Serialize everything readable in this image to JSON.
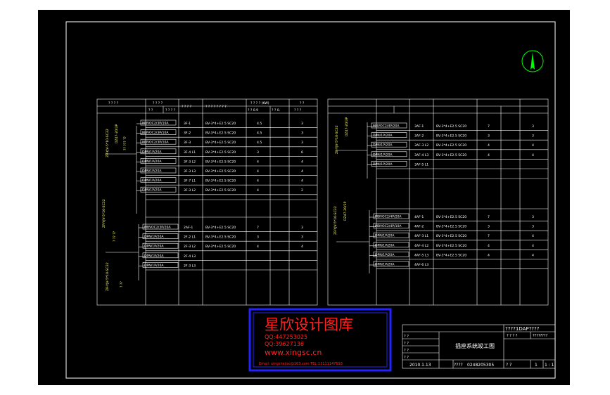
{
  "left_table": {
    "header": {
      "col_a": "? ? ? ?",
      "col_b": "? ? ? ?",
      "col_b_sub1": "? ?",
      "col_b_sub2": "? ? ? ?",
      "col_c": "? ? ? ?",
      "col_d": "? ? ? ? ? ? ? ?",
      "col_e": "? ? ? ? (KW)",
      "col_e_sub1": "? ? 0.9",
      "col_e_sub2": "? ? 0.",
      "col_f": "? ?",
      "col_f_sub": "? ? ?"
    },
    "side_labels": [
      "ZR-YJV-5*10-SC32",
      "DZ47-20/3P",
      "?? ??? ??",
      "ZR-YJV-5*10-SC32",
      "? ?? ??",
      "ZR-YJV-5*10-SC32",
      "? ??"
    ],
    "breaker_rows": [
      {
        "breaker": "MBVOC2/3P/10A",
        "circuit": "3F-1",
        "cable": "BV-3*4+E2.5 SC20",
        "kw": "4.5",
        "count": "3"
      },
      {
        "breaker": "MBVOC2/3P/10A",
        "circuit": "3F-2",
        "cable": "BV-3*4+E2.5 SC20",
        "kw": "4.5",
        "count": "3"
      },
      {
        "breaker": "MBVOC2/3P/10A",
        "circuit": "3F-3",
        "cable": "BV-3*4+E2.5 SC20",
        "kw": "4.5",
        "count": "3"
      },
      {
        "breaker": "DPN/1P/20A",
        "circuit": "3F-4 L1",
        "cable": "BV-3*4+E2.5 SC20",
        "kw": "3",
        "count": "6"
      },
      {
        "breaker": "DPN/1P/20A",
        "circuit": "3F-3 L2",
        "cable": "BV-3*4+E2.5 SC20",
        "kw": "4",
        "count": "4"
      },
      {
        "breaker": "DPN/1P/20A",
        "circuit": "3F-3 L3",
        "cable": "BV-3*4+E2.5 SC20",
        "kw": "4",
        "count": "4"
      },
      {
        "breaker": "DPN/1P/20A",
        "circuit": "3F-7 L1",
        "cable": "BV-3*4+E2.5 SC20",
        "kw": "4",
        "count": "4"
      },
      {
        "breaker": "DPN/1P/20A",
        "circuit": "3F-3 L2",
        "cable": "BV-3*4+E2.5 SC20",
        "kw": "4",
        "count": "2"
      }
    ],
    "breaker_rows_2": [
      {
        "breaker": "MBVOC2/3P/20A",
        "circuit": "2AF-1",
        "cable": "BV-3*4+E2.5 SC20",
        "kw": "7",
        "count": "3"
      },
      {
        "breaker": "DPN/1P/20A",
        "circuit": "2F-2 L1",
        "cable": "BV-3*4+E2.5 SC20",
        "kw": "3",
        "count": "3"
      },
      {
        "breaker": "DPN/1P/20A",
        "circuit": "2F-3 L2",
        "cable": "BV-3*4+E2.5 SC20",
        "kw": "4",
        "count": "4"
      },
      {
        "breaker": "DPN/1P/20A",
        "circuit": "2F-4 L3",
        "cable": "",
        "kw": "",
        "count": ""
      },
      {
        "breaker": "DPN/1P/20A",
        "circuit": "2F-3 L3",
        "cable": "",
        "kw": "",
        "count": ""
      }
    ]
  },
  "right_table": {
    "breaker_rows": [
      {
        "breaker": "MBVOC2/4P/20A",
        "circuit": "3AF-1",
        "cable": "BV-3*4+E2.5 SC20",
        "kw": "7",
        "count": "3"
      },
      {
        "breaker": "DPN/1P/20A",
        "circuit": "3AF-2",
        "cable": "BV-3*4+E2.5 SC20",
        "kw": "3",
        "count": "3"
      },
      {
        "breaker": "DPN/1P/20A",
        "circuit": "3AF-3 L2",
        "cable": "BV-3*4+E2.5 SC20",
        "kw": "4",
        "count": "4"
      },
      {
        "breaker": "DPN/1P/20A",
        "circuit": "3AF-4 L3",
        "cable": "BV-3*4+E2.5 SC20",
        "kw": "4",
        "count": "4"
      },
      {
        "breaker": "DPN/1P/20A",
        "circuit": "3AF-5 L1",
        "cable": "",
        "kw": "",
        "count": ""
      }
    ],
    "breaker_rows_2": [
      {
        "breaker": "MBVOC2/4P/20A",
        "circuit": "4AF-1",
        "cable": "BV-3*4+E2.5 SC20",
        "kw": "7",
        "count": "3"
      },
      {
        "breaker": "MBVOC2/4P/10A",
        "circuit": "4AF-2",
        "cable": "BV-3*4+E2.5 SC20",
        "kw": "3",
        "count": "3"
      },
      {
        "breaker": "DPN/1P/20A",
        "circuit": "4AF-3 L1",
        "cable": "BV-3*4+E2.5 SC20",
        "kw": "7",
        "count": "4"
      },
      {
        "breaker": "DPN/1P/20A",
        "circuit": "4AF-4 L2",
        "cable": "BV-3*4+E2.5 SC20",
        "kw": "4",
        "count": "4"
      },
      {
        "breaker": "DPN/1P/20A",
        "circuit": "4AF-5 L3",
        "cable": "BV-3*4+E2.5 SC20",
        "kw": "4",
        "count": "4"
      },
      {
        "breaker": "DPN/1P/20A",
        "circuit": "4AF-6 L3",
        "cable": "",
        "kw": "",
        "count": ""
      }
    ]
  },
  "watermark": {
    "title": "星欣设计图库",
    "qq1": "QQ:447253025",
    "qq2": "QQ:39627136",
    "url": "www.xingsc.cn",
    "email": "Email: xingshejisc@163.com   TEL:13111147593"
  },
  "title_block": {
    "project": "????1DAP????",
    "sub1": "? ? ? ?",
    "sub2": "????????",
    "rows": [
      "? ?",
      "? ?",
      "? ?",
      "? ?"
    ],
    "drawing_name": "插座系统竣工图",
    "date": "2010.1.13",
    "code_label": "????",
    "code": "0248205305",
    "sheet_label": "? ?",
    "sheet": "1",
    "of": "1 : 1"
  },
  "colors": {
    "background": "#000000",
    "lines": "#ffffff",
    "north_arrow": "#00ff00",
    "watermark_border": "#2222ff",
    "watermark_text": "#ff2222"
  }
}
